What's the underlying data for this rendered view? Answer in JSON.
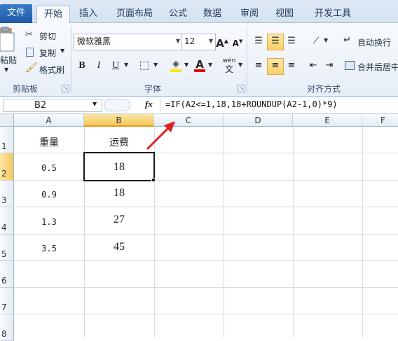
{
  "tabs": [
    "文件",
    "开始",
    "插入",
    "页面布局",
    "公式",
    "数据",
    "审阅",
    "视图",
    "开发工具"
  ],
  "clipboard": {
    "paste_label": "粘贴",
    "cut_label": "剪切",
    "copy_label": "复制",
    "format_painter_label": "格式刷",
    "group_label": "剪贴板"
  },
  "font": {
    "family": "微软雅黑",
    "size": "12",
    "group_label": "字体",
    "bold": "B",
    "italic": "I",
    "underline": "U",
    "grow": "A",
    "shrink": "A",
    "font_color_letter": "A",
    "phonetic": "wén"
  },
  "alignment": {
    "wrap_text_label": "自动换行",
    "merge_center_label": "合并后居中",
    "group_label": "对齐方式"
  },
  "formula_bar": {
    "name_box": "B2",
    "fx": "fx",
    "formula": "=IF(A2<=1,18,18+ROUNDUP(A2-1,0)*9)"
  },
  "columns": [
    "A",
    "B",
    "C",
    "D",
    "E",
    "F"
  ],
  "rows": [
    "1",
    "2",
    "3",
    "4",
    "5",
    "6",
    "7",
    "8"
  ],
  "cells": {
    "A1": "重量",
    "B1": "运费",
    "A2": "0.5",
    "B2": "18",
    "A3": "0.9",
    "B3": "18",
    "A4": "1.3",
    "B4": "27",
    "A5": "3.5",
    "B5": "45"
  },
  "colors": {
    "file_tab": "#2a69b8",
    "selected_header": "#f5c75a",
    "annotation_arrow": "#e02020"
  }
}
